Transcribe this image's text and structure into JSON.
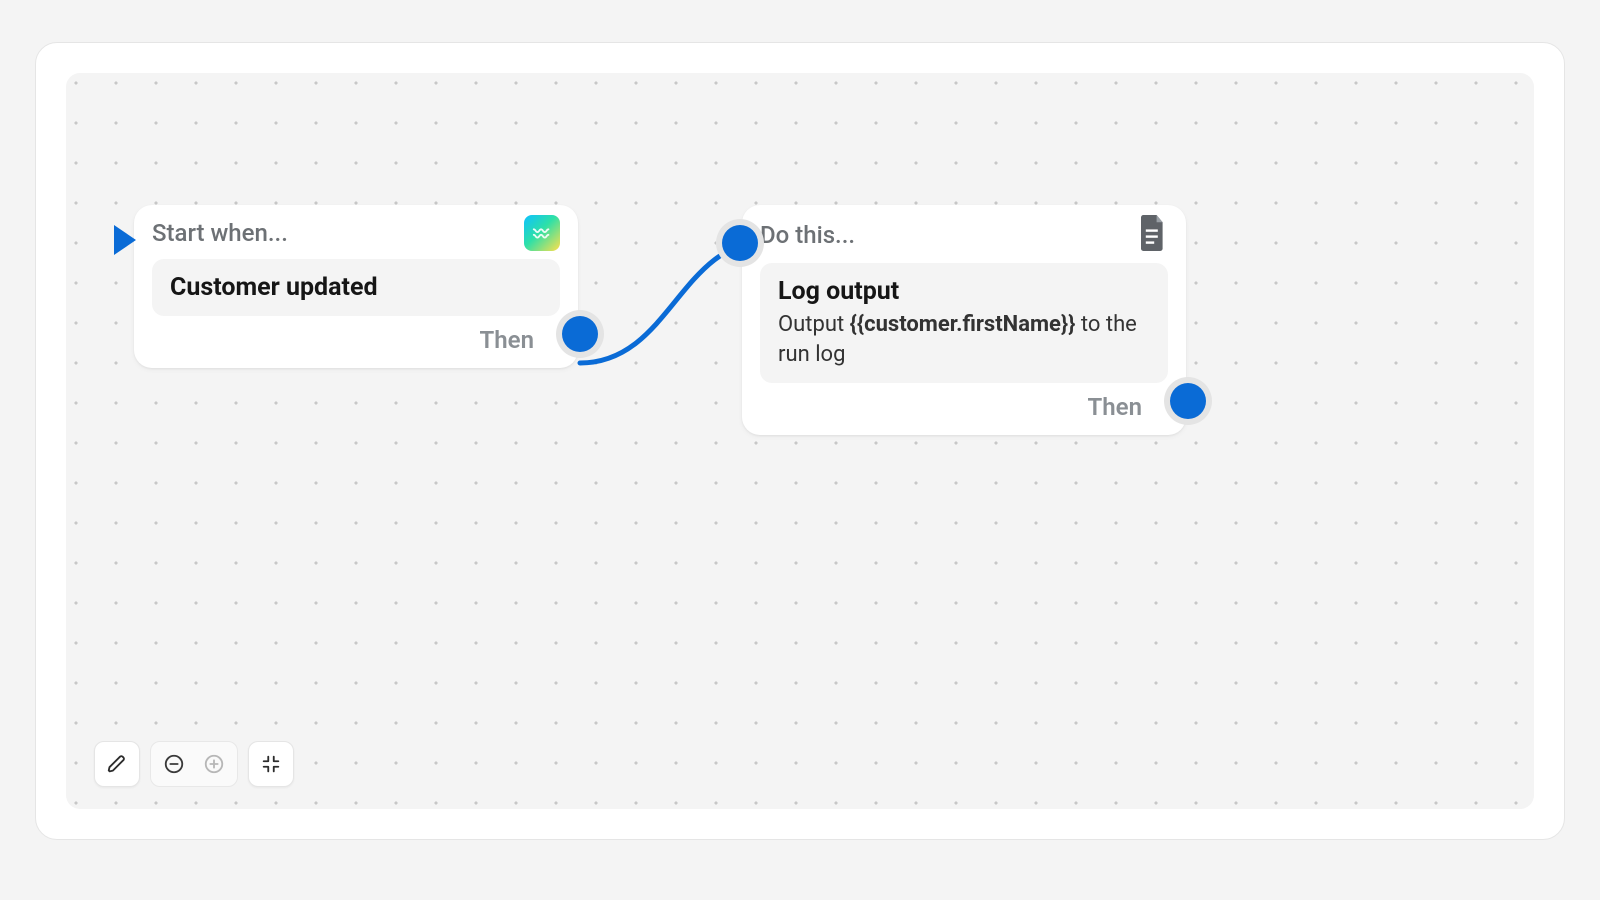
{
  "nodes": {
    "start": {
      "headerLabel": "Start when...",
      "title": "Customer updated",
      "footerLabel": "Then"
    },
    "action": {
      "headerLabel": "Do this...",
      "title": "Log output",
      "descPrefix": "Output ",
      "descVar": "{{customer.firstName}}",
      "descSuffix": " to the run log",
      "footerLabel": "Then"
    }
  },
  "colors": {
    "accent": "#0a6bd6"
  },
  "icons": {
    "startApp": "wave-app-icon",
    "actionApp": "document-icon"
  }
}
